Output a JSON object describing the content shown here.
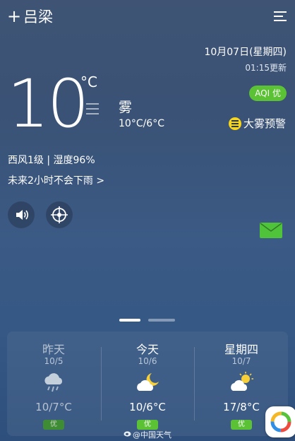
{
  "header": {
    "add_symbol": "+",
    "city": "吕梁",
    "menu_icon": "hamburger-menu-icon"
  },
  "current": {
    "date": "10月07日(星期四)",
    "update_time": "01:15更新",
    "aqi_badge": "AQI 优",
    "temperature": "10",
    "unit": "°C",
    "condition": "雾",
    "temp_range": "10°C/6°C",
    "warning": "大雾预警",
    "wind_humidity": "西风1级 | 湿度96%",
    "rain_forecast": "未来2小时不会下雨 >"
  },
  "icons": {
    "sound": "speaker-icon",
    "locate": "locate-icon",
    "mail": "mail-icon",
    "warning": "fog-warning-icon"
  },
  "forecast": [
    {
      "name": "昨天",
      "date": "10/5",
      "icon": "rain-cloud-icon",
      "range": "10/7°C",
      "aqi": "优"
    },
    {
      "name": "今天",
      "date": "10/6",
      "icon": "partly-cloudy-night-icon",
      "range": "10/6°C",
      "aqi": "优"
    },
    {
      "name": "星期四",
      "date": "10/7",
      "icon": "partly-cloudy-day-icon",
      "range": "17/8°C",
      "aqi": "优"
    }
  ],
  "watermark": "@中国天气",
  "colors": {
    "aqi_green": "#5bc236",
    "warning_yellow": "#f6d61d",
    "mail_green": "#4fc33a"
  }
}
